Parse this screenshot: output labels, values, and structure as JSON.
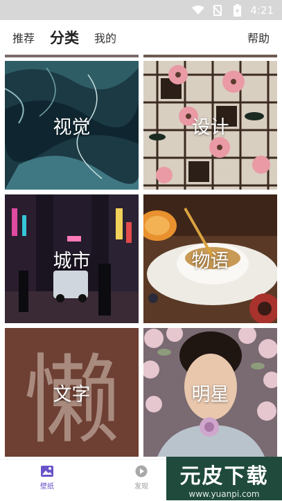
{
  "status": {
    "time": "4:21"
  },
  "nav": {
    "tabs": [
      "推荐",
      "分类",
      "我的"
    ],
    "active": 1,
    "help": "帮助"
  },
  "categories": [
    {
      "label": "视觉",
      "theme": "teal-marble"
    },
    {
      "label": "设计",
      "theme": "floral-pattern"
    },
    {
      "label": "城市",
      "theme": "night-street"
    },
    {
      "label": "物语",
      "theme": "cup-sunflower"
    },
    {
      "label": "文字",
      "theme": "lazy-char"
    },
    {
      "label": "明星",
      "theme": "portrait-roses"
    }
  ],
  "decor_text": {
    "big_char": "懒"
  },
  "bottom_nav": [
    {
      "label": "壁纸",
      "icon": "image-icon",
      "active": true
    },
    {
      "label": "发现",
      "icon": "play-icon",
      "active": false
    }
  ],
  "watermark": {
    "title": "元皮下载",
    "url": "www.yuanpi.com"
  },
  "colors": {
    "accent": "#6a53c9",
    "watermark_bg": "#1f4a3c"
  }
}
